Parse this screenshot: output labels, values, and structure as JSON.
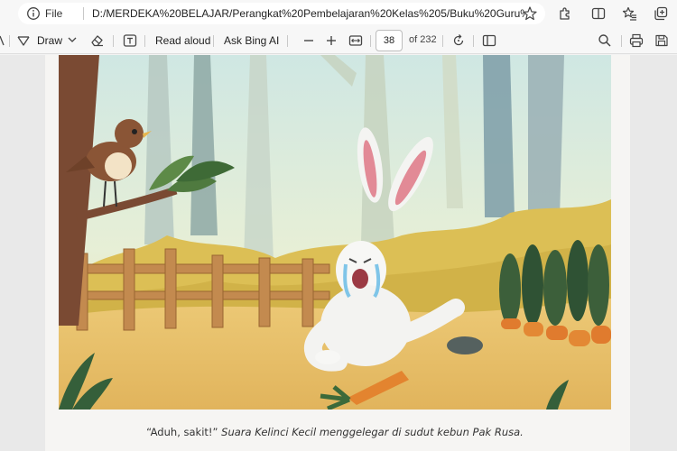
{
  "address_bar": {
    "scheme_label": "File",
    "url": "D:/MERDEKA%20BELAJAR/Perangkat%20Pembelajaran%20Kelas%205/Buku%20Guru%20dan%20Sisw..."
  },
  "pdf_toolbar": {
    "draw_label": "Draw",
    "read_aloud_label": "Read aloud",
    "ask_bing_label": "Ask Bing AI",
    "page_number": "38",
    "page_total": "of 232"
  },
  "document": {
    "caption_quote": "“Aduh, sakit!”",
    "caption_rest": " Suara Kelinci Kecil menggelegar di sudut kebun Pak Rusa."
  }
}
